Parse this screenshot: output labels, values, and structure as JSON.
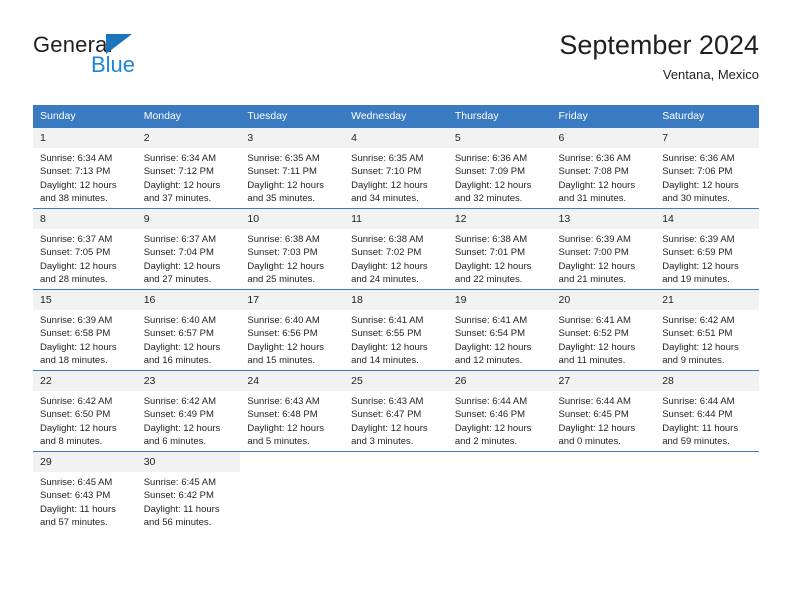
{
  "brand": {
    "name_part1": "General",
    "name_part2": "Blue",
    "triangle_color": "#1c74bb",
    "blue_color": "#1c86d8"
  },
  "header": {
    "title": "September 2024",
    "subtitle": "Ventana, Mexico",
    "accent_color": "#3a7ac0",
    "daynum_band_color": "#f2f2f2"
  },
  "weekday_headers": [
    "Sunday",
    "Monday",
    "Tuesday",
    "Wednesday",
    "Thursday",
    "Friday",
    "Saturday"
  ],
  "weeks": [
    [
      {
        "day": "1",
        "lines": [
          "Sunrise: 6:34 AM",
          "Sunset: 7:13 PM",
          "Daylight: 12 hours",
          "and 38 minutes."
        ]
      },
      {
        "day": "2",
        "lines": [
          "Sunrise: 6:34 AM",
          "Sunset: 7:12 PM",
          "Daylight: 12 hours",
          "and 37 minutes."
        ]
      },
      {
        "day": "3",
        "lines": [
          "Sunrise: 6:35 AM",
          "Sunset: 7:11 PM",
          "Daylight: 12 hours",
          "and 35 minutes."
        ]
      },
      {
        "day": "4",
        "lines": [
          "Sunrise: 6:35 AM",
          "Sunset: 7:10 PM",
          "Daylight: 12 hours",
          "and 34 minutes."
        ]
      },
      {
        "day": "5",
        "lines": [
          "Sunrise: 6:36 AM",
          "Sunset: 7:09 PM",
          "Daylight: 12 hours",
          "and 32 minutes."
        ]
      },
      {
        "day": "6",
        "lines": [
          "Sunrise: 6:36 AM",
          "Sunset: 7:08 PM",
          "Daylight: 12 hours",
          "and 31 minutes."
        ]
      },
      {
        "day": "7",
        "lines": [
          "Sunrise: 6:36 AM",
          "Sunset: 7:06 PM",
          "Daylight: 12 hours",
          "and 30 minutes."
        ]
      }
    ],
    [
      {
        "day": "8",
        "lines": [
          "Sunrise: 6:37 AM",
          "Sunset: 7:05 PM",
          "Daylight: 12 hours",
          "and 28 minutes."
        ]
      },
      {
        "day": "9",
        "lines": [
          "Sunrise: 6:37 AM",
          "Sunset: 7:04 PM",
          "Daylight: 12 hours",
          "and 27 minutes."
        ]
      },
      {
        "day": "10",
        "lines": [
          "Sunrise: 6:38 AM",
          "Sunset: 7:03 PM",
          "Daylight: 12 hours",
          "and 25 minutes."
        ]
      },
      {
        "day": "11",
        "lines": [
          "Sunrise: 6:38 AM",
          "Sunset: 7:02 PM",
          "Daylight: 12 hours",
          "and 24 minutes."
        ]
      },
      {
        "day": "12",
        "lines": [
          "Sunrise: 6:38 AM",
          "Sunset: 7:01 PM",
          "Daylight: 12 hours",
          "and 22 minutes."
        ]
      },
      {
        "day": "13",
        "lines": [
          "Sunrise: 6:39 AM",
          "Sunset: 7:00 PM",
          "Daylight: 12 hours",
          "and 21 minutes."
        ]
      },
      {
        "day": "14",
        "lines": [
          "Sunrise: 6:39 AM",
          "Sunset: 6:59 PM",
          "Daylight: 12 hours",
          "and 19 minutes."
        ]
      }
    ],
    [
      {
        "day": "15",
        "lines": [
          "Sunrise: 6:39 AM",
          "Sunset: 6:58 PM",
          "Daylight: 12 hours",
          "and 18 minutes."
        ]
      },
      {
        "day": "16",
        "lines": [
          "Sunrise: 6:40 AM",
          "Sunset: 6:57 PM",
          "Daylight: 12 hours",
          "and 16 minutes."
        ]
      },
      {
        "day": "17",
        "lines": [
          "Sunrise: 6:40 AM",
          "Sunset: 6:56 PM",
          "Daylight: 12 hours",
          "and 15 minutes."
        ]
      },
      {
        "day": "18",
        "lines": [
          "Sunrise: 6:41 AM",
          "Sunset: 6:55 PM",
          "Daylight: 12 hours",
          "and 14 minutes."
        ]
      },
      {
        "day": "19",
        "lines": [
          "Sunrise: 6:41 AM",
          "Sunset: 6:54 PM",
          "Daylight: 12 hours",
          "and 12 minutes."
        ]
      },
      {
        "day": "20",
        "lines": [
          "Sunrise: 6:41 AM",
          "Sunset: 6:52 PM",
          "Daylight: 12 hours",
          "and 11 minutes."
        ]
      },
      {
        "day": "21",
        "lines": [
          "Sunrise: 6:42 AM",
          "Sunset: 6:51 PM",
          "Daylight: 12 hours",
          "and 9 minutes."
        ]
      }
    ],
    [
      {
        "day": "22",
        "lines": [
          "Sunrise: 6:42 AM",
          "Sunset: 6:50 PM",
          "Daylight: 12 hours",
          "and 8 minutes."
        ]
      },
      {
        "day": "23",
        "lines": [
          "Sunrise: 6:42 AM",
          "Sunset: 6:49 PM",
          "Daylight: 12 hours",
          "and 6 minutes."
        ]
      },
      {
        "day": "24",
        "lines": [
          "Sunrise: 6:43 AM",
          "Sunset: 6:48 PM",
          "Daylight: 12 hours",
          "and 5 minutes."
        ]
      },
      {
        "day": "25",
        "lines": [
          "Sunrise: 6:43 AM",
          "Sunset: 6:47 PM",
          "Daylight: 12 hours",
          "and 3 minutes."
        ]
      },
      {
        "day": "26",
        "lines": [
          "Sunrise: 6:44 AM",
          "Sunset: 6:46 PM",
          "Daylight: 12 hours",
          "and 2 minutes."
        ]
      },
      {
        "day": "27",
        "lines": [
          "Sunrise: 6:44 AM",
          "Sunset: 6:45 PM",
          "Daylight: 12 hours",
          "and 0 minutes."
        ]
      },
      {
        "day": "28",
        "lines": [
          "Sunrise: 6:44 AM",
          "Sunset: 6:44 PM",
          "Daylight: 11 hours",
          "and 59 minutes."
        ]
      }
    ],
    [
      {
        "day": "29",
        "lines": [
          "Sunrise: 6:45 AM",
          "Sunset: 6:43 PM",
          "Daylight: 11 hours",
          "and 57 minutes."
        ]
      },
      {
        "day": "30",
        "lines": [
          "Sunrise: 6:45 AM",
          "Sunset: 6:42 PM",
          "Daylight: 11 hours",
          "and 56 minutes."
        ]
      },
      {
        "day": "",
        "lines": []
      },
      {
        "day": "",
        "lines": []
      },
      {
        "day": "",
        "lines": []
      },
      {
        "day": "",
        "lines": []
      },
      {
        "day": "",
        "lines": []
      }
    ]
  ]
}
